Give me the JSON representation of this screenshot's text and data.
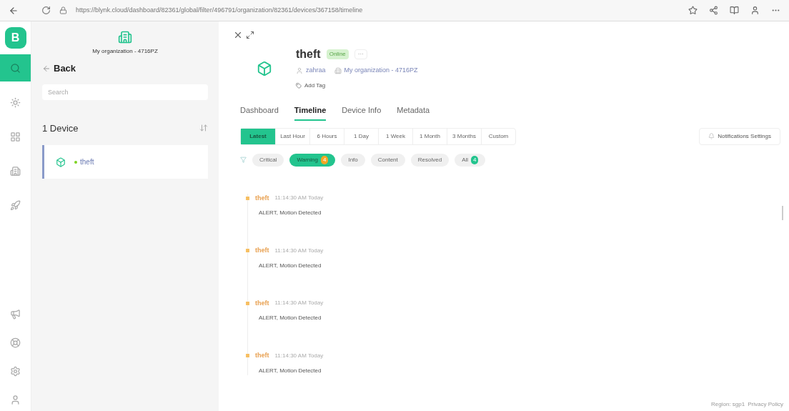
{
  "browser": {
    "url": "https://blynk.cloud/dashboard/82361/global/filter/496791/organization/82361/devices/367158/timeline"
  },
  "rail": {
    "logo": "B",
    "items": [
      {
        "kind": "search",
        "selected": true
      },
      {
        "kind": "sun",
        "selected": false
      },
      {
        "kind": "grid",
        "selected": false
      },
      {
        "kind": "building",
        "selected": false
      },
      {
        "kind": "rocket",
        "selected": false
      }
    ],
    "bottom": [
      {
        "kind": "megaphone"
      },
      {
        "kind": "lifebuoy"
      },
      {
        "kind": "gear"
      },
      {
        "kind": "user"
      }
    ]
  },
  "sidebar": {
    "org": "My organization - 4716PZ",
    "back": "Back",
    "search": {
      "placeholder": "Search"
    },
    "count": "1 Device",
    "devices": [
      {
        "name": "theft",
        "selected": true
      }
    ]
  },
  "device": {
    "name": "theft",
    "status": "Online",
    "more": "···",
    "owner": "zahraa",
    "org": "My organization - 4716PZ",
    "add_tag": "Add Tag"
  },
  "tabs": [
    {
      "label": "Dashboard",
      "selected": false
    },
    {
      "label": "Timeline",
      "selected": true
    },
    {
      "label": "Device Info",
      "selected": false
    },
    {
      "label": "Metadata",
      "selected": false
    }
  ],
  "ranges": [
    {
      "label": "Latest",
      "selected": true
    },
    {
      "label": "Last Hour",
      "selected": false
    },
    {
      "label": "6 Hours",
      "selected": false
    },
    {
      "label": "1 Day",
      "selected": false
    },
    {
      "label": "1 Week",
      "selected": false
    },
    {
      "label": "1 Month",
      "selected": false
    },
    {
      "label": "3 Months",
      "selected": false
    },
    {
      "label": "Custom",
      "selected": false
    }
  ],
  "notifications_button": "Notifications Settings",
  "filters": [
    {
      "label": "Critical",
      "selected": false
    },
    {
      "label": "Warning",
      "selected": true,
      "count": "4",
      "color": "#f5a623"
    },
    {
      "label": "Info",
      "selected": false
    },
    {
      "label": "Content",
      "selected": false
    },
    {
      "label": "Resolved",
      "selected": false
    },
    {
      "label": "All",
      "selected": false,
      "count": "4",
      "color": "#23c48e"
    }
  ],
  "events": [
    {
      "device": "theft",
      "time": "11:14:30 AM Today",
      "message": "ALERT, Motion Detected"
    },
    {
      "device": "theft",
      "time": "11:14:30 AM Today",
      "message": "ALERT, Motion Detected"
    },
    {
      "device": "theft",
      "time": "11:14:30 AM Today",
      "message": "ALERT, Motion Detected"
    },
    {
      "device": "theft",
      "time": "11:14:30 AM Today",
      "message": "ALERT, Motion Detected"
    }
  ],
  "footer": {
    "region": "Region: sgp1",
    "privacy": "Privacy Policy"
  }
}
